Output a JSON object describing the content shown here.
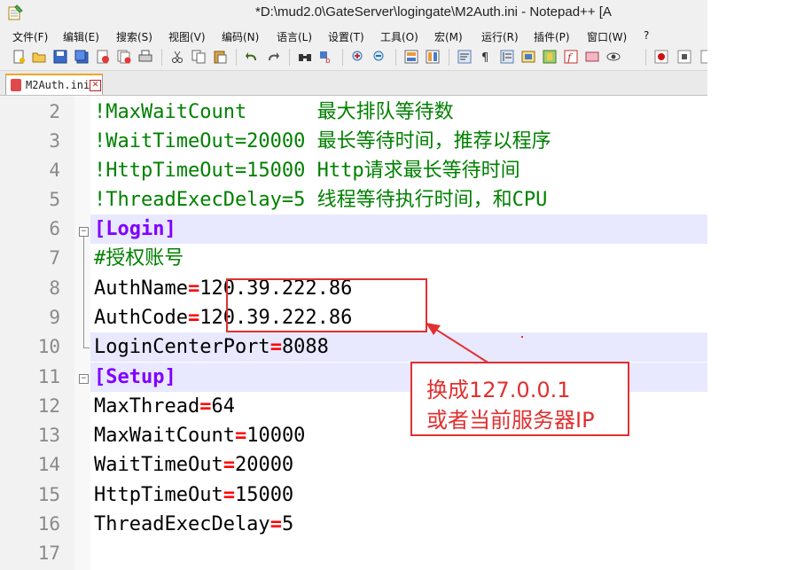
{
  "window": {
    "title": "*D:\\mud2.0\\GateServer\\logingate\\M2Auth.ini - Notepad++ [A"
  },
  "menu": [
    "文件(F)",
    "编辑(E)",
    "搜索(S)",
    "视图(V)",
    "编码(N)",
    "语言(L)",
    "设置(T)",
    "工具(O)",
    "宏(M)",
    "运行(R)",
    "插件(P)",
    "窗口(W)",
    "?"
  ],
  "tab": {
    "label": "M2Auth.ini",
    "close": "✕"
  },
  "editor": {
    "lines": [
      {
        "num": "2",
        "text": "!MaxWaitCount      最大排队等待数"
      },
      {
        "num": "3",
        "text": "!WaitTimeOut=20000 最长等待时间，推荐以程序"
      },
      {
        "num": "4",
        "text": "!HttpTimeOut=15000 Http请求最长等待时间"
      },
      {
        "num": "5",
        "text": "!ThreadExecDelay=5 线程等待执行时间，和CPU"
      },
      {
        "num": "6",
        "text": "[Login]"
      },
      {
        "num": "7",
        "text": "#授权账号"
      },
      {
        "num": "8",
        "key": "AuthName",
        "eq": "=",
        "val": "120.39.222.86"
      },
      {
        "num": "9",
        "key": "AuthCode",
        "eq": "=",
        "val": "120.39.222.86"
      },
      {
        "num": "10",
        "key": "LoginCenterPort",
        "eq": "=",
        "val": "8088"
      },
      {
        "num": "11",
        "text": "[Setup]"
      },
      {
        "num": "12",
        "key": "MaxThread",
        "eq": "=",
        "val": "64"
      },
      {
        "num": "13",
        "key": "MaxWaitCount",
        "eq": "=",
        "val": "10000"
      },
      {
        "num": "14",
        "key": "WaitTimeOut",
        "eq": "=",
        "val": "20000"
      },
      {
        "num": "15",
        "key": "HttpTimeOut",
        "eq": "=",
        "val": "15000"
      },
      {
        "num": "16",
        "key": "ThreadExecDelay",
        "eq": "=",
        "val": "5"
      },
      {
        "num": "17",
        "text": ""
      }
    ]
  },
  "annotation": {
    "line1": "换成127.0.0.1",
    "line2": "或者当前服务器IP"
  },
  "colors": {
    "comment": "#008000",
    "section": "#8000ff",
    "operator": "#ff0000",
    "annotation": "#e03030",
    "current_line": "#e8e8ff"
  }
}
